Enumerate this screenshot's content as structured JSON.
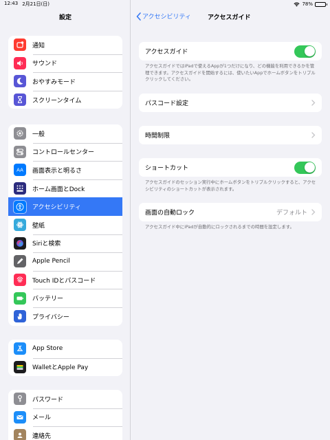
{
  "status": {
    "time": "12:43",
    "date": "2月21日(日)",
    "battery": "78%",
    "battery_level": 0.78
  },
  "sidebar": {
    "title": "設定",
    "groups": [
      {
        "items": [
          {
            "label": "通知",
            "icon": "notifications-icon",
            "color": "#ff3b30"
          },
          {
            "label": "サウンド",
            "icon": "sound-icon",
            "color": "#ff2d55"
          },
          {
            "label": "おやすみモード",
            "icon": "moon-icon",
            "color": "#5856d6"
          },
          {
            "label": "スクリーンタイム",
            "icon": "hourglass-icon",
            "color": "#5856d6"
          }
        ]
      },
      {
        "items": [
          {
            "label": "一般",
            "icon": "gear-icon",
            "color": "#8e8e93"
          },
          {
            "label": "コントロールセンター",
            "icon": "switches-icon",
            "color": "#8e8e93"
          },
          {
            "label": "画面表示と明るさ",
            "icon": "display-icon",
            "color": "#007aff"
          },
          {
            "label": "ホーム画面とDock",
            "icon": "home-grid-icon",
            "color": "#2c2c7e"
          },
          {
            "label": "アクセシビリティ",
            "icon": "accessibility-icon",
            "color": "#007aff",
            "selected": true
          },
          {
            "label": "壁紙",
            "icon": "wallpaper-icon",
            "color": "#35aadc"
          },
          {
            "label": "Siriと検索",
            "icon": "siri-icon",
            "color": "#1c1c1e"
          },
          {
            "label": "Apple Pencil",
            "icon": "pencil-icon",
            "color": "#636366"
          },
          {
            "label": "Touch IDとパスコード",
            "icon": "fingerprint-icon",
            "color": "#ff2d55"
          },
          {
            "label": "バッテリー",
            "icon": "battery-icon",
            "color": "#34c759"
          },
          {
            "label": "プライバシー",
            "icon": "hand-icon",
            "color": "#2f63d8"
          }
        ]
      },
      {
        "items": [
          {
            "label": "App Store",
            "icon": "app-store-icon",
            "color": "#1c8ef9"
          },
          {
            "label": "WalletとApple Pay",
            "icon": "wallet-icon",
            "color": "#1c1c1e"
          }
        ]
      },
      {
        "items": [
          {
            "label": "パスワード",
            "icon": "key-icon",
            "color": "#8e8e93"
          },
          {
            "label": "メール",
            "icon": "mail-icon",
            "color": "#1c8ef9"
          },
          {
            "label": "連絡先",
            "icon": "contacts-icon",
            "color": "#a2845e"
          }
        ]
      }
    ]
  },
  "detail": {
    "back_label": "アクセシビリティ",
    "title": "アクセスガイド",
    "guided_access": {
      "label": "アクセスガイド",
      "on": true,
      "note": "アクセスガイドではiPadで使えるAppが1つだけになり、どの機能を利用できるかを管理できます。アクセスガイドを開始するには、使いたいAppでホームボタンをトリプルクリックしてください。"
    },
    "passcode": {
      "label": "パスコード設定"
    },
    "time_limits": {
      "label": "時間制限"
    },
    "shortcut": {
      "label": "ショートカット",
      "on": true,
      "note": "アクセスガイドのセッション実行中にホームボタンをトリプルクリックすると、アクセシビリティのショートカットが表示されます。"
    },
    "auto_lock": {
      "label": "画面の自動ロック",
      "value": "デフォルト",
      "note": "アクセスガイド中にiPadが自動的にロックされるまでの時間を設定します。"
    }
  },
  "colors": {
    "accent": "#3478f6",
    "toggle_on": "#34c759",
    "selected_row": "#3478f6"
  }
}
